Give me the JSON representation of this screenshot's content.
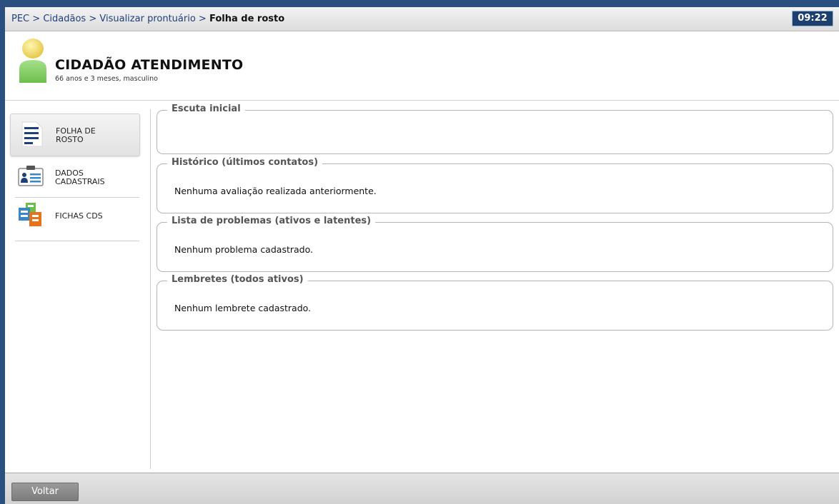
{
  "breadcrumb": {
    "items": [
      "PEC",
      "Cidadãos",
      "Visualizar prontuário"
    ],
    "separator": ">",
    "current": "Folha de rosto"
  },
  "clock": "09:22",
  "patient": {
    "name": "CIDADÃO ATENDIMENTO",
    "info": "66 anos e 3 meses, masculino"
  },
  "sidebar": {
    "items": [
      {
        "line1": "FOLHA DE",
        "line2": "ROSTO",
        "icon": "document-lines-icon",
        "active": true
      },
      {
        "line1": "DADOS",
        "line2": "CADASTRAIS",
        "icon": "id-card-icon",
        "active": false
      },
      {
        "line1": "FICHAS CDS",
        "line2": "",
        "icon": "forms-icon",
        "active": false
      }
    ]
  },
  "panels": {
    "escuta": {
      "title": "Escuta inicial",
      "text": ""
    },
    "historico": {
      "title": "Histórico (últimos contatos)",
      "text": "Nenhuma avaliação realizada anteriormente."
    },
    "problemas": {
      "title": "Lista de problemas (ativos e latentes)",
      "text": "Nenhum problema cadastrado."
    },
    "lembretes": {
      "title": "Lembretes (todos ativos)",
      "text": "Nenhum lembrete cadastrado."
    }
  },
  "footer": {
    "back_label": "Voltar"
  },
  "colors": {
    "frame": "#2b4f7e",
    "clock_bg": "#1c3f6e",
    "link": "#1f3f7a"
  }
}
